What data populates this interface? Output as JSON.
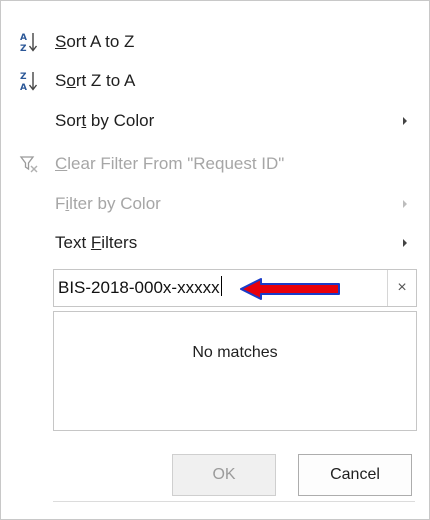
{
  "menu": {
    "sort_az": {
      "prefix": "",
      "accel": "S",
      "rest": "ort A to Z"
    },
    "sort_za": {
      "prefix": "S",
      "accel": "o",
      "rest": "rt Z to A"
    },
    "sort_color": {
      "prefix": "Sor",
      "accel": "t",
      "rest": " by Color"
    },
    "clear_filter": {
      "prefix": "",
      "accel": "C",
      "rest": "lear Filter From \"Request ID\""
    },
    "filter_color": {
      "prefix": "F",
      "accel": "i",
      "rest": "lter by Color"
    },
    "text_filters": {
      "prefix": "Text ",
      "accel": "F",
      "rest": "ilters"
    }
  },
  "icons": {
    "sort_az": "sort-ascending-icon",
    "sort_za": "sort-descending-icon",
    "clear_filter": "clear-filter-icon",
    "clear_search": "close-icon",
    "annotation": "red-arrow-icon"
  },
  "search": {
    "value": "BIS-2018-000x-xxxxx",
    "clear_label": "×"
  },
  "results": {
    "empty_text": "No matches"
  },
  "buttons": {
    "ok": "OK",
    "cancel": "Cancel"
  },
  "colors": {
    "annotation_red": "#e8000b",
    "annotation_blue": "#1a3cc8",
    "disabled_text": "#a6a6a6"
  }
}
